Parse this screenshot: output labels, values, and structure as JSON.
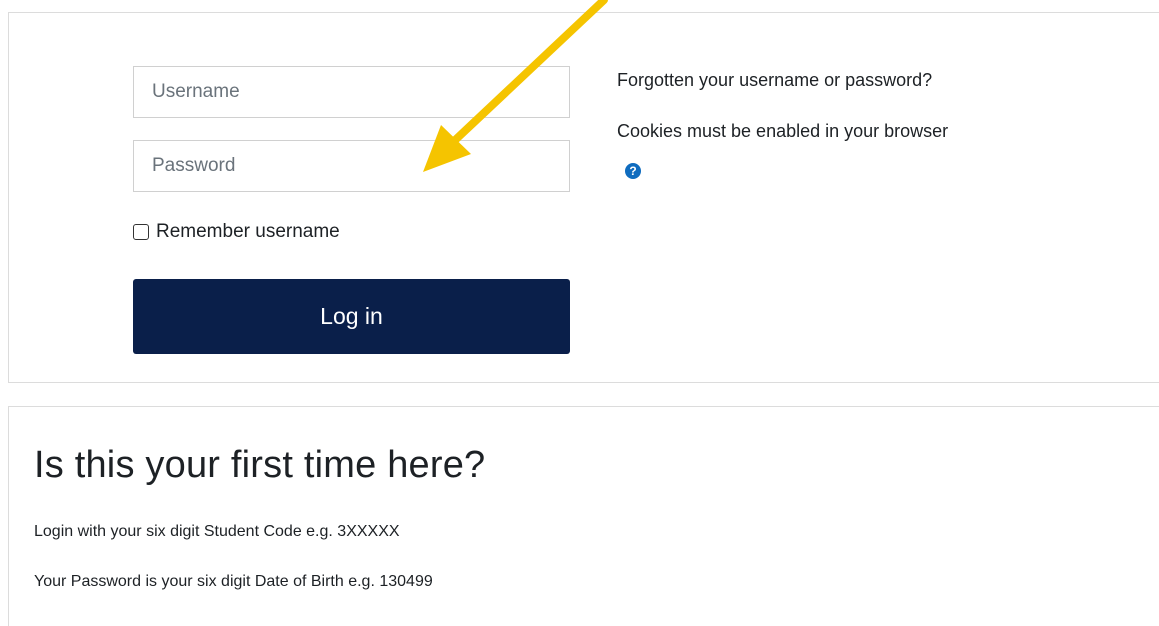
{
  "login_form": {
    "username_placeholder": "Username",
    "password_placeholder": "Password",
    "remember_label": "Remember username",
    "login_button": "Log in"
  },
  "side_links": {
    "forgot": "Forgotten your username or password?",
    "cookies": "Cookies must be enabled in your browser",
    "help_icon": "question-circle-icon"
  },
  "first_time": {
    "title": "Is this your first time here?",
    "line1": "Login with your six digit Student Code e.g. 3XXXXX",
    "line2": "Your Password is your six digit Date of Birth e.g. 130499"
  },
  "colors": {
    "login_button_bg": "#0a1f4a",
    "help_icon": "#0f6cbf",
    "annotation_arrow": "#f5c400"
  }
}
